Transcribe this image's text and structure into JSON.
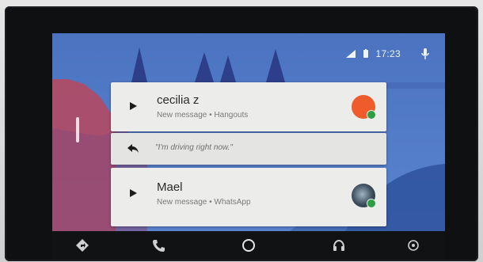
{
  "status_bar": {
    "time": "17:23",
    "signal_icon": "signal-icon",
    "battery_icon": "battery-icon",
    "mic_icon": "mic-icon"
  },
  "notifications": [
    {
      "sender": "cecilia z",
      "subtitle": "New message • Hangouts",
      "avatar_color": "#ef5b2b",
      "badge_color": "#2e9e44"
    },
    {
      "sender": "Mael",
      "subtitle": "New message • WhatsApp",
      "avatar_color": "#3c4d5b",
      "badge_color": "#2e9e44"
    }
  ],
  "reply": {
    "text": "\"I'm driving right now.\""
  },
  "nav_bar": {
    "items": [
      "navigation-icon",
      "phone-icon",
      "home-icon",
      "headphones-icon",
      "power-icon"
    ]
  },
  "colors": {
    "wallpaper_blue": "#4f79c6",
    "card_background": "#ececea",
    "nav_background": "#111214"
  }
}
